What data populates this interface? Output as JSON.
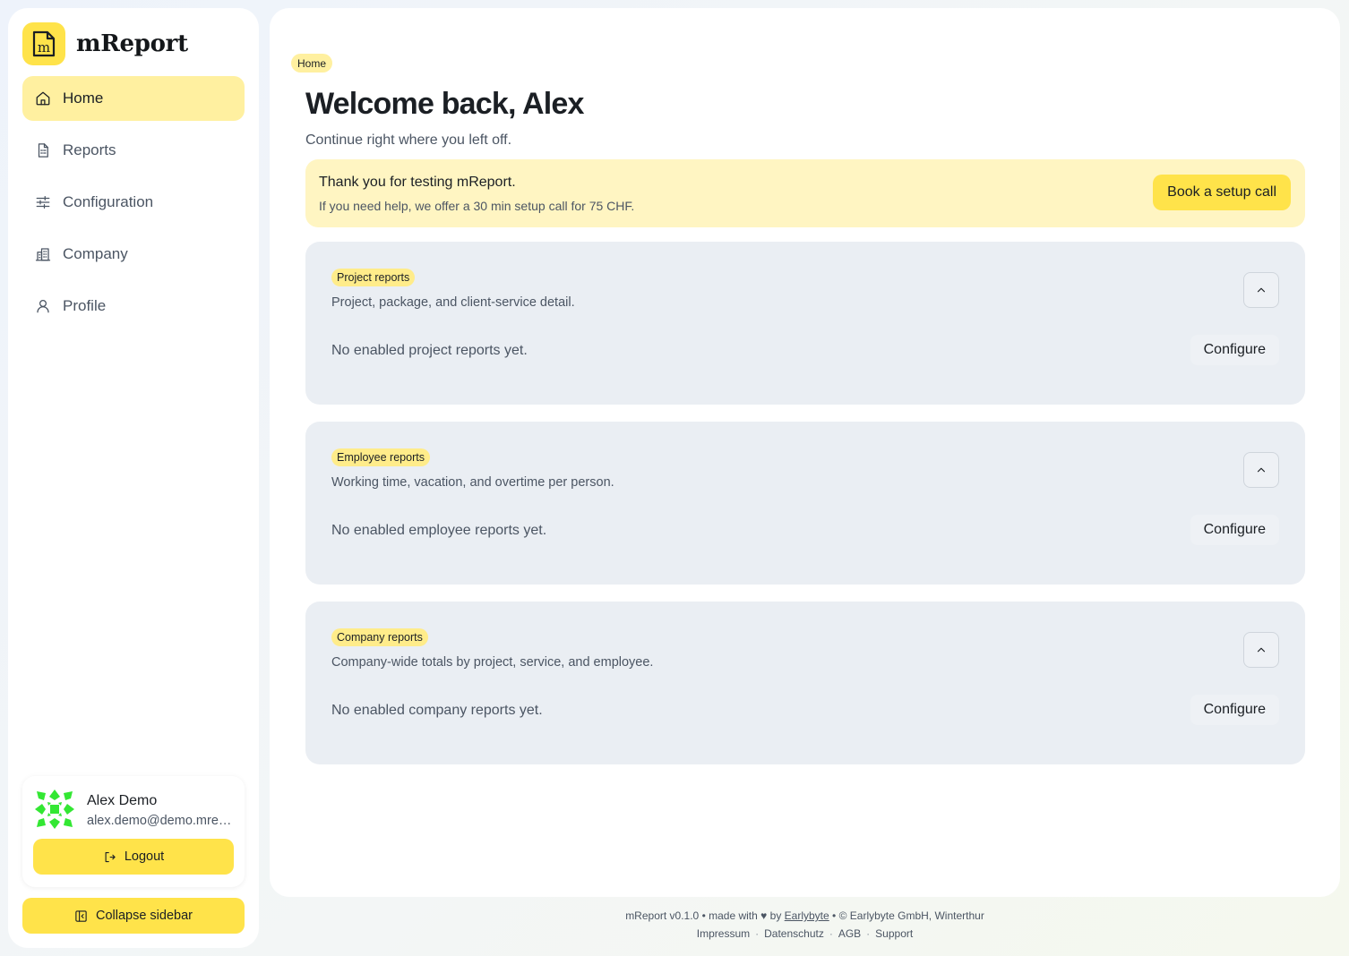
{
  "app": {
    "name": "mReport",
    "logo_letter": "m",
    "accent_color": "#ffe34a"
  },
  "sidebar": {
    "items": [
      {
        "label": "Home",
        "icon": "home-icon",
        "active": true
      },
      {
        "label": "Reports",
        "icon": "report-icon",
        "active": false
      },
      {
        "label": "Configuration",
        "icon": "sliders-icon",
        "active": false
      },
      {
        "label": "Company",
        "icon": "building-icon",
        "active": false
      },
      {
        "label": "Profile",
        "icon": "user-icon",
        "active": false
      }
    ],
    "user": {
      "name": "Alex Demo",
      "email": "alex.demo@demo.mreport.ch"
    },
    "logout_label": "Logout",
    "collapse_label": "Collapse sidebar"
  },
  "main": {
    "breadcrumb": "Home",
    "title": "Welcome back, Alex",
    "subtitle": "Continue right where you left off.",
    "banner": {
      "title": "Thank you for testing mReport.",
      "text": "If you need help, we offer a 30 min setup call for 75 CHF.",
      "button_label": "Book a setup call"
    },
    "sections": [
      {
        "badge": "Project reports",
        "description": "Project, package, and client-service detail.",
        "empty": "No enabled project reports yet.",
        "configure_label": "Configure"
      },
      {
        "badge": "Employee reports",
        "description": "Working time, vacation, and overtime per person.",
        "empty": "No enabled employee reports yet.",
        "configure_label": "Configure"
      },
      {
        "badge": "Company reports",
        "description": "Company-wide totals by project, service, and employee.",
        "empty": "No enabled company reports yet.",
        "configure_label": "Configure"
      }
    ]
  },
  "footer": {
    "version": "mReport v0.1.0",
    "made_with": "made with",
    "by": "by",
    "company_link": "Earlybyte",
    "copyright": "© Earlybyte GmbH, Winterthur",
    "links": [
      "Impressum",
      "Datenschutz",
      "AGB",
      "Support"
    ]
  }
}
